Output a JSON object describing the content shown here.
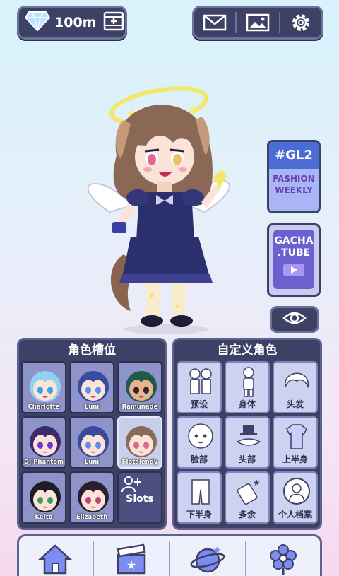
{
  "currency": {
    "amount": "100m",
    "gem_icon": "diamond-icon",
    "add_icon": "film-plus-icon"
  },
  "topbar_right": {
    "icons": [
      "mail-icon",
      "gallery-icon",
      "gear-icon"
    ]
  },
  "side": {
    "gl2_title": "#GL2",
    "gl2_sub1": "FASHION",
    "gl2_sub2": "WEEKLY",
    "tube_line1": "GACHA",
    "tube_line2": ".TUBE",
    "eye_icon": "eye-icon"
  },
  "slots_panel": {
    "title": "角色槽位",
    "slots": [
      {
        "name": "Charlotte",
        "hair": "#8fd3f0",
        "skin": "#fbe3d8",
        "eye": "#3fa0e0"
      },
      {
        "name": "Luni",
        "hair": "#3a4a9c",
        "skin": "#fbe3d8",
        "eye": "#5c8ef0"
      },
      {
        "name": "Ramunade",
        "hair": "#1f5a4c",
        "skin": "#e9b38e",
        "eye": "#2a2a2a"
      },
      {
        "name": "DJ Phantom",
        "hair": "#3b2a6e",
        "skin": "#fbe3d8",
        "eye": "#6a3ad0"
      },
      {
        "name": "Luni",
        "hair": "#3a4a9c",
        "skin": "#fbe3d8",
        "eye": "#5c8ef0"
      },
      {
        "name": "Flotalendy",
        "hair": "#8a6a58",
        "skin": "#fbe3d8",
        "eye": "#d96a8a"
      },
      {
        "name": "Keito",
        "hair": "#1d1d24",
        "skin": "#fbe3d8",
        "eye": "#3b9a6a"
      },
      {
        "name": "Elizabeth",
        "hair": "#2a1f2f",
        "skin": "#fbe3d8",
        "eye": "#b8437a"
      }
    ],
    "add_label": "Slots"
  },
  "custom_panel": {
    "title": "自定义角色",
    "items": [
      {
        "label": "预设",
        "icon": "preset-icon"
      },
      {
        "label": "身体",
        "icon": "body-icon"
      },
      {
        "label": "头发",
        "icon": "hair-icon"
      },
      {
        "label": "脸部",
        "icon": "face-icon"
      },
      {
        "label": "头部",
        "icon": "head-accessory-icon"
      },
      {
        "label": "上半身",
        "icon": "upper-body-icon"
      },
      {
        "label": "下半身",
        "icon": "lower-body-icon"
      },
      {
        "label": "多余",
        "icon": "extra-icon"
      },
      {
        "label": "个人档案",
        "icon": "profile-icon"
      }
    ]
  },
  "bottom_nav": {
    "icons": [
      "home-icon",
      "studio-icon",
      "planet-icon",
      "flower-icon"
    ]
  },
  "colors": {
    "panel": "#3d4166",
    "accent": "#6b7199"
  }
}
